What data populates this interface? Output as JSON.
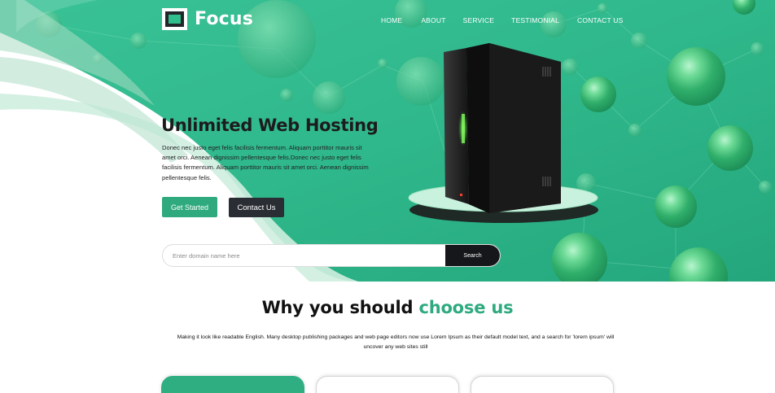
{
  "brand": {
    "name": "Focus"
  },
  "nav": {
    "items": [
      "HOME",
      "ABOUT",
      "SERVICE",
      "TESTIMONIAL",
      "CONTACT US"
    ]
  },
  "hero": {
    "title": "Unlimited Web Hosting",
    "description": "Donec nec justo eget felis facilisis fermentum. Aliquam porttitor mauris sit amet orci. Aenean dignissim pellentesque felis.Donec nec justo eget felis facilisis fermentum. Aliquam porttitor mauris sit amet orci. Aenean dignissim pellentesque felis.",
    "get_started_label": "Get Started",
    "contact_label": "Contact Us"
  },
  "search": {
    "placeholder": "Enter domain name here",
    "value": "",
    "button_label": "Search"
  },
  "why": {
    "title_prefix": "Why you should ",
    "title_accent": "choose us",
    "description": "Making it look like readable English. Many desktop publishing packages and web page editors now use Lorem Ipsum as their default model text, and a search for 'lorem ipsum' will uncover any web sites still"
  },
  "colors": {
    "accent": "#2faa7e",
    "hero_green": "#2db88a",
    "dark": "#2a2d33"
  },
  "icons": {
    "logo": "square-logo-icon",
    "server": "server-tower-illustration"
  }
}
